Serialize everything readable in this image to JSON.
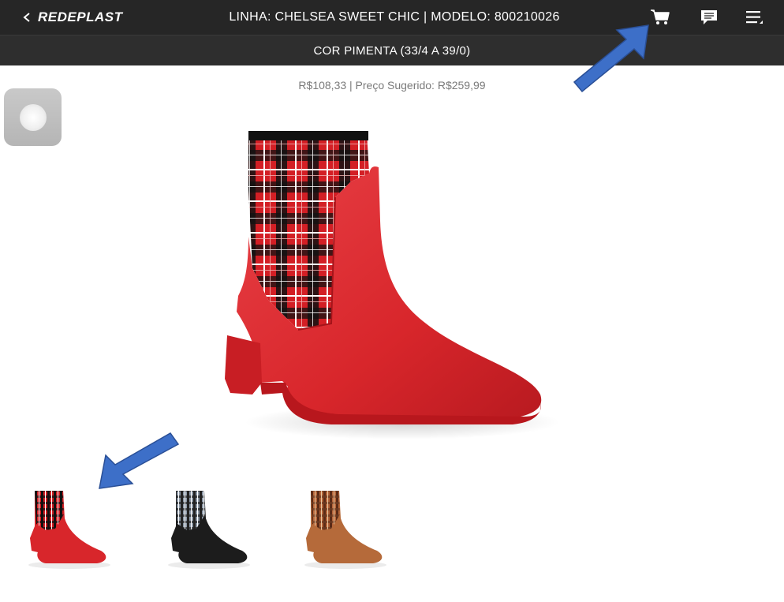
{
  "header": {
    "back_label": "<",
    "brand": "REDEPLAST",
    "title": "LINHA: CHELSEA SWEET CHIC | MODELO: 800210026",
    "subtitle": "COR PIMENTA (33/4 A 39/0)"
  },
  "icons": {
    "cart": "cart-icon",
    "chat": "chat-icon",
    "menu": "menu-icon"
  },
  "product": {
    "price_line": "R$108,33 | Preço Sugerido: R$259,99",
    "variants": [
      {
        "color_name": "red",
        "boot_color": "#d8262b",
        "pattern": "red-plaid"
      },
      {
        "color_name": "black",
        "boot_color": "#1c1c1c",
        "pattern": "gray-plaid"
      },
      {
        "color_name": "brown",
        "boot_color": "#b56a3a",
        "pattern": "brown-plaid"
      }
    ]
  },
  "colors": {
    "topbar": "#262626",
    "subbar": "#2e2e2e",
    "annotation_arrow": "#3d6fc8",
    "boot_red": "#d8262b"
  }
}
